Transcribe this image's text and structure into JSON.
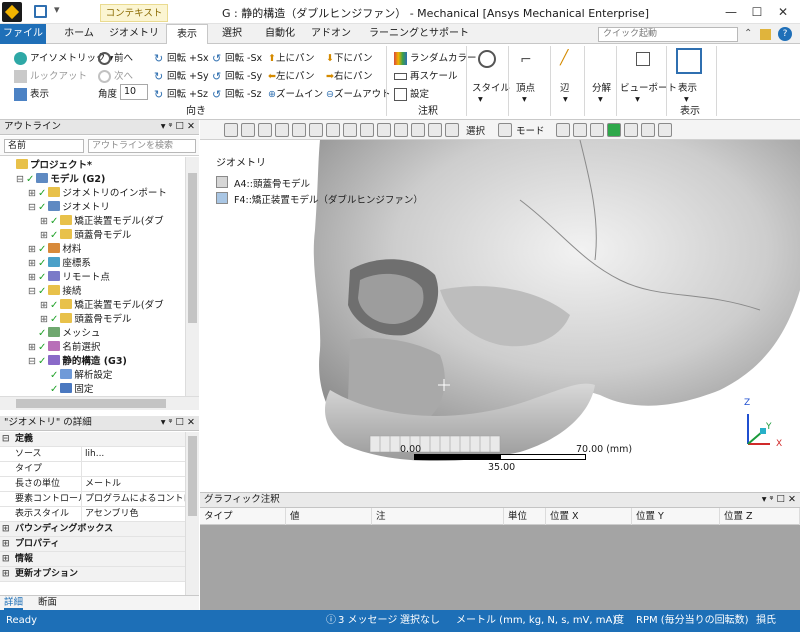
{
  "title_bar": {
    "context_tab": "コンテキスト",
    "window_title": "G : 静的構造（ダブルヒンジファン） - Mechanical [Ansys Mechanical Enterprise]",
    "buttons": [
      "—",
      "☐",
      "✕"
    ]
  },
  "ribbon_tabs": {
    "items": [
      "ファイル",
      "ホーム",
      "ジオメトリ",
      "表示",
      "選択",
      "自動化",
      "アドオン",
      "ラーニングとサポート"
    ],
    "active": "表示",
    "quick_launch_placeholder": "クイック起動"
  },
  "ribbon": {
    "orientation": {
      "isometric": "アイソメトリック",
      "front": "前へ",
      "look_at": "ルックアット",
      "next": "次へ",
      "display": "表示",
      "angle_label": "角度",
      "angle_value": "10",
      "rot_px": "回転 +Sx",
      "rot_py": "回転 +Sy",
      "rot_pz": "回転 +Sz",
      "rot_mx": "回転 -Sx",
      "rot_my": "回転 -Sy",
      "rot_mz": "回転 -Sz",
      "pan_up": "上にパン",
      "pan_left": "左にパン",
      "zoom_in": "ズームイン",
      "pan_down": "下にパン",
      "pan_right": "右にパン",
      "zoom_out": "ズームアウト",
      "group_label": "向き"
    },
    "annotation": {
      "random_color": "ランダムカラー",
      "rescale": "再スケール",
      "settings": "設定",
      "group_label": "注釈"
    },
    "style_label": "スタイル",
    "vertex_label": "頂点",
    "edge_label": "辺",
    "decompose_label": "分解",
    "viewport_label": "ビューポート",
    "display_label": "表示",
    "display_group_label": "表示"
  },
  "toolbar": {
    "select_label": "選択",
    "mode_label": "モード"
  },
  "outline": {
    "title": "アウトライン",
    "pin_icons": "▾ ᵠ ☐ ✕",
    "search_field": "名前",
    "search_placeholder": "アウトラインを検索",
    "tree": [
      {
        "label": "プロジェクト*",
        "level": 0,
        "bold": true,
        "expander": ""
      },
      {
        "label": "モデル (G2)",
        "level": 1,
        "bold": true,
        "expander": "⊟"
      },
      {
        "label": "ジオメトリのインポート",
        "level": 2,
        "bold": false,
        "expander": "⊞"
      },
      {
        "label": "ジオメトリ",
        "level": 2,
        "bold": false,
        "expander": "⊟"
      },
      {
        "label": "矯正装置モデル(ダブ",
        "level": 3,
        "bold": false,
        "expander": "⊞"
      },
      {
        "label": "頭蓋骨モデル",
        "level": 3,
        "bold": false,
        "expander": "⊞"
      },
      {
        "label": "材料",
        "level": 2,
        "bold": false,
        "expander": "⊞"
      },
      {
        "label": "座標系",
        "level": 2,
        "bold": false,
        "expander": "⊞"
      },
      {
        "label": "リモート点",
        "level": 2,
        "bold": false,
        "expander": "⊞"
      },
      {
        "label": "接続",
        "level": 2,
        "bold": false,
        "expander": "⊟"
      },
      {
        "label": "矯正装置モデル(ダブ",
        "level": 3,
        "bold": false,
        "expander": "⊞"
      },
      {
        "label": "頭蓋骨モデル",
        "level": 3,
        "bold": false,
        "expander": "⊞"
      },
      {
        "label": "メッシュ",
        "level": 2,
        "bold": false,
        "expander": ""
      },
      {
        "label": "名前選択",
        "level": 2,
        "bold": false,
        "expander": "⊞"
      },
      {
        "label": "静的構造 (G3)",
        "level": 2,
        "bold": true,
        "expander": "⊟"
      },
      {
        "label": "解析設定",
        "level": 3,
        "bold": false,
        "expander": ""
      },
      {
        "label": "固定",
        "level": 3,
        "bold": false,
        "expander": ""
      }
    ]
  },
  "details": {
    "title": "\"ジオメトリ\" の詳細",
    "rows": [
      {
        "type": "section",
        "key": "定義",
        "value": "",
        "expander": "⊟"
      },
      {
        "type": "row",
        "key": "ソース",
        "value": "lih..."
      },
      {
        "type": "row",
        "key": "タイプ",
        "value": ""
      },
      {
        "type": "row",
        "key": "長さの単位",
        "value": "メートル"
      },
      {
        "type": "row",
        "key": "要素コントロール",
        "value": "プログラムによるコントロー..."
      },
      {
        "type": "row",
        "key": "表示スタイル",
        "value": "アセンブリ色"
      },
      {
        "type": "section",
        "key": "バウンディングボックス",
        "value": "",
        "expander": "⊞"
      },
      {
        "type": "section",
        "key": "プロパティ",
        "value": "",
        "expander": "⊞"
      },
      {
        "type": "section",
        "key": "情報",
        "value": "",
        "expander": "⊞"
      },
      {
        "type": "section",
        "key": "更新オプション",
        "value": "",
        "expander": "⊞"
      }
    ],
    "tabs": [
      "詳細",
      "断面"
    ]
  },
  "viewport": {
    "legend_title": "ジオメトリ",
    "legend_items": [
      {
        "label": "A4::頭蓋骨モデル",
        "color": "#d6d6d6"
      },
      {
        "label": "F4::矯正装置モデル（ダブルヒンジファン）",
        "color": "#a9c6e4"
      }
    ],
    "scale": {
      "left": "0.00",
      "right": "70.00 (mm)",
      "mid": "35.00"
    },
    "triad": {
      "x": "X",
      "y": "Y",
      "z": "Z"
    }
  },
  "graphics_annotation": {
    "title": "グラフィック注釈",
    "columns": [
      "タイプ",
      "値",
      "注",
      "単位",
      "位置 X",
      "位置 Y",
      "位置 Z"
    ]
  },
  "statusbar": {
    "ready": "Ready",
    "messages": "3 メッセージ",
    "selection": "選択なし",
    "units": "メートル (mm, kg, N, s, mV, mA)",
    "angle": "度",
    "rpm": "RPM (毎分当りの回転数)",
    "damage": "損氏"
  },
  "colors": {
    "accent_blue": "#1d6fb7",
    "skull": "#cfcfcf",
    "check_green": "#22a32a",
    "annotation_bg": "#a4a4a4"
  }
}
